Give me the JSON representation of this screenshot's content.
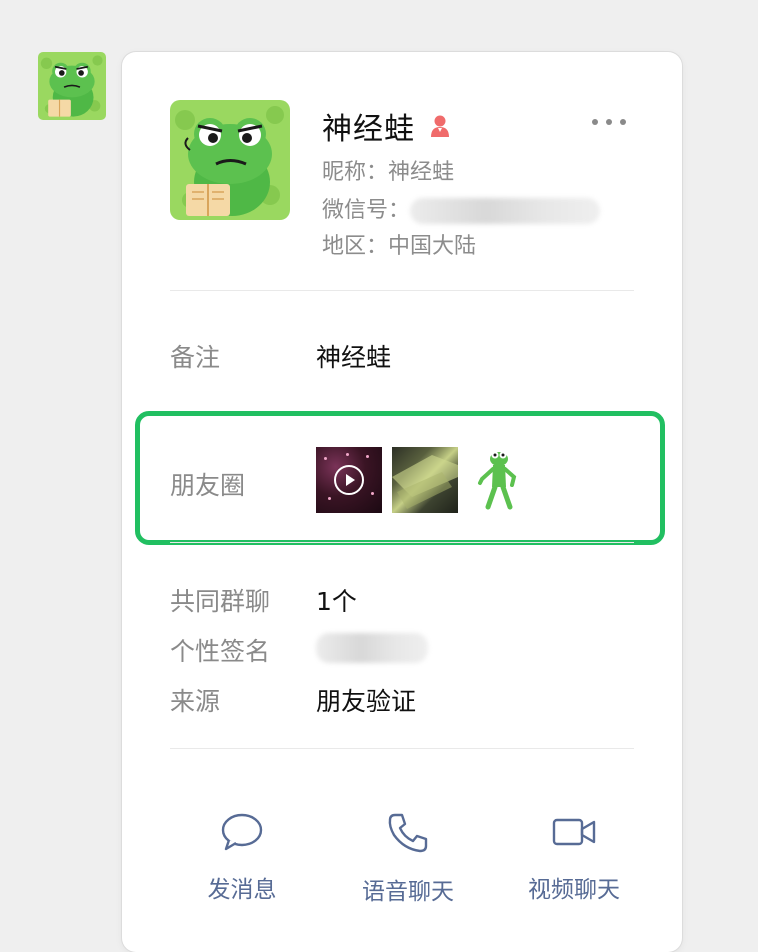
{
  "profile": {
    "display_name": "神经蛙",
    "nickname_label": "昵称：",
    "nickname": "神经蛙",
    "wechat_id_label": "微信号：",
    "region_label": "地区：",
    "region": "中国大陆",
    "gender_icon": "female-icon",
    "gender_color": "#f06b6b"
  },
  "remark": {
    "label": "备注",
    "value": "神经蛙"
  },
  "moments": {
    "label": "朋友圈",
    "thumbnails": [
      "video-thumbnail",
      "photo-thumbnail",
      "frog-sticker-thumbnail"
    ],
    "highlight_color": "#21bf61"
  },
  "details": {
    "groups_label": "共同群聊",
    "groups_value": "1个",
    "signature_label": "个性签名",
    "source_label": "来源",
    "source_value": "朋友验证"
  },
  "actions": {
    "message": "发消息",
    "voice": "语音聊天",
    "video": "视频聊天",
    "color": "#576b95"
  }
}
